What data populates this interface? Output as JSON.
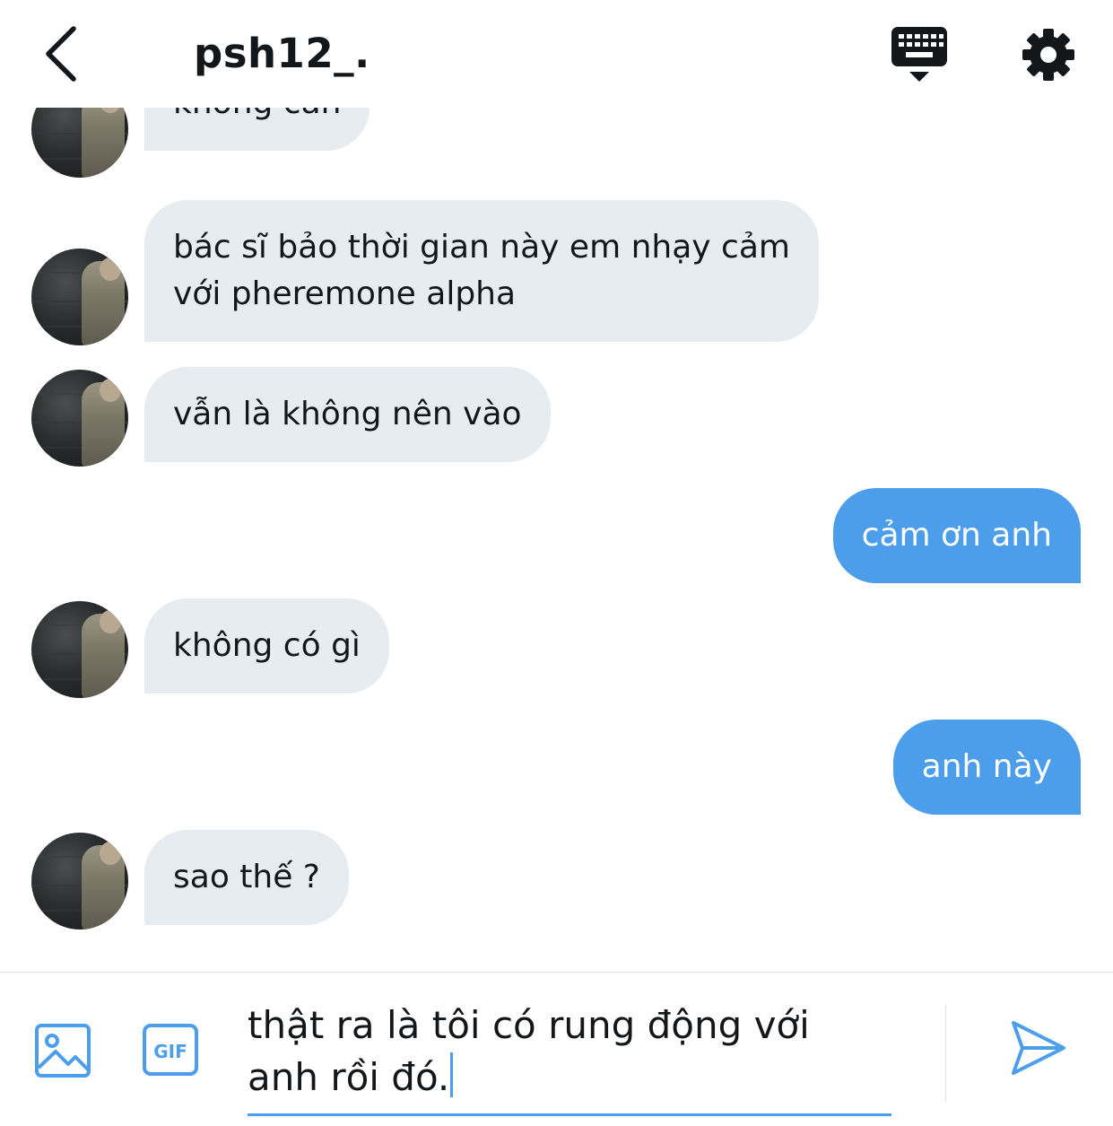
{
  "header": {
    "title": "psh12_.",
    "back_icon": "chevron-left-icon",
    "keyboard_icon": "keyboard-icon",
    "settings_icon": "gear-icon"
  },
  "colors": {
    "accent": "#4c9eeb",
    "incoming_bubble": "#e6ecf0",
    "text": "#14171a"
  },
  "messages": [
    {
      "direction": "in",
      "text": "không cần"
    },
    {
      "direction": "in",
      "text": "bác sĩ bảo thời gian này em nhạy cảm\nvới pheremone alpha"
    },
    {
      "direction": "in",
      "text": "vẫn là không nên vào"
    },
    {
      "direction": "out",
      "text": "cảm ơn anh"
    },
    {
      "direction": "in",
      "text": "không có gì"
    },
    {
      "direction": "out",
      "text": "anh này"
    },
    {
      "direction": "in",
      "text": "sao thế ?"
    }
  ],
  "composer": {
    "value": "thật ra là tôi có rung động với\nanh rồi đó.",
    "media_icon": "image-icon",
    "gif_label": "GIF",
    "send_icon": "send-icon"
  }
}
